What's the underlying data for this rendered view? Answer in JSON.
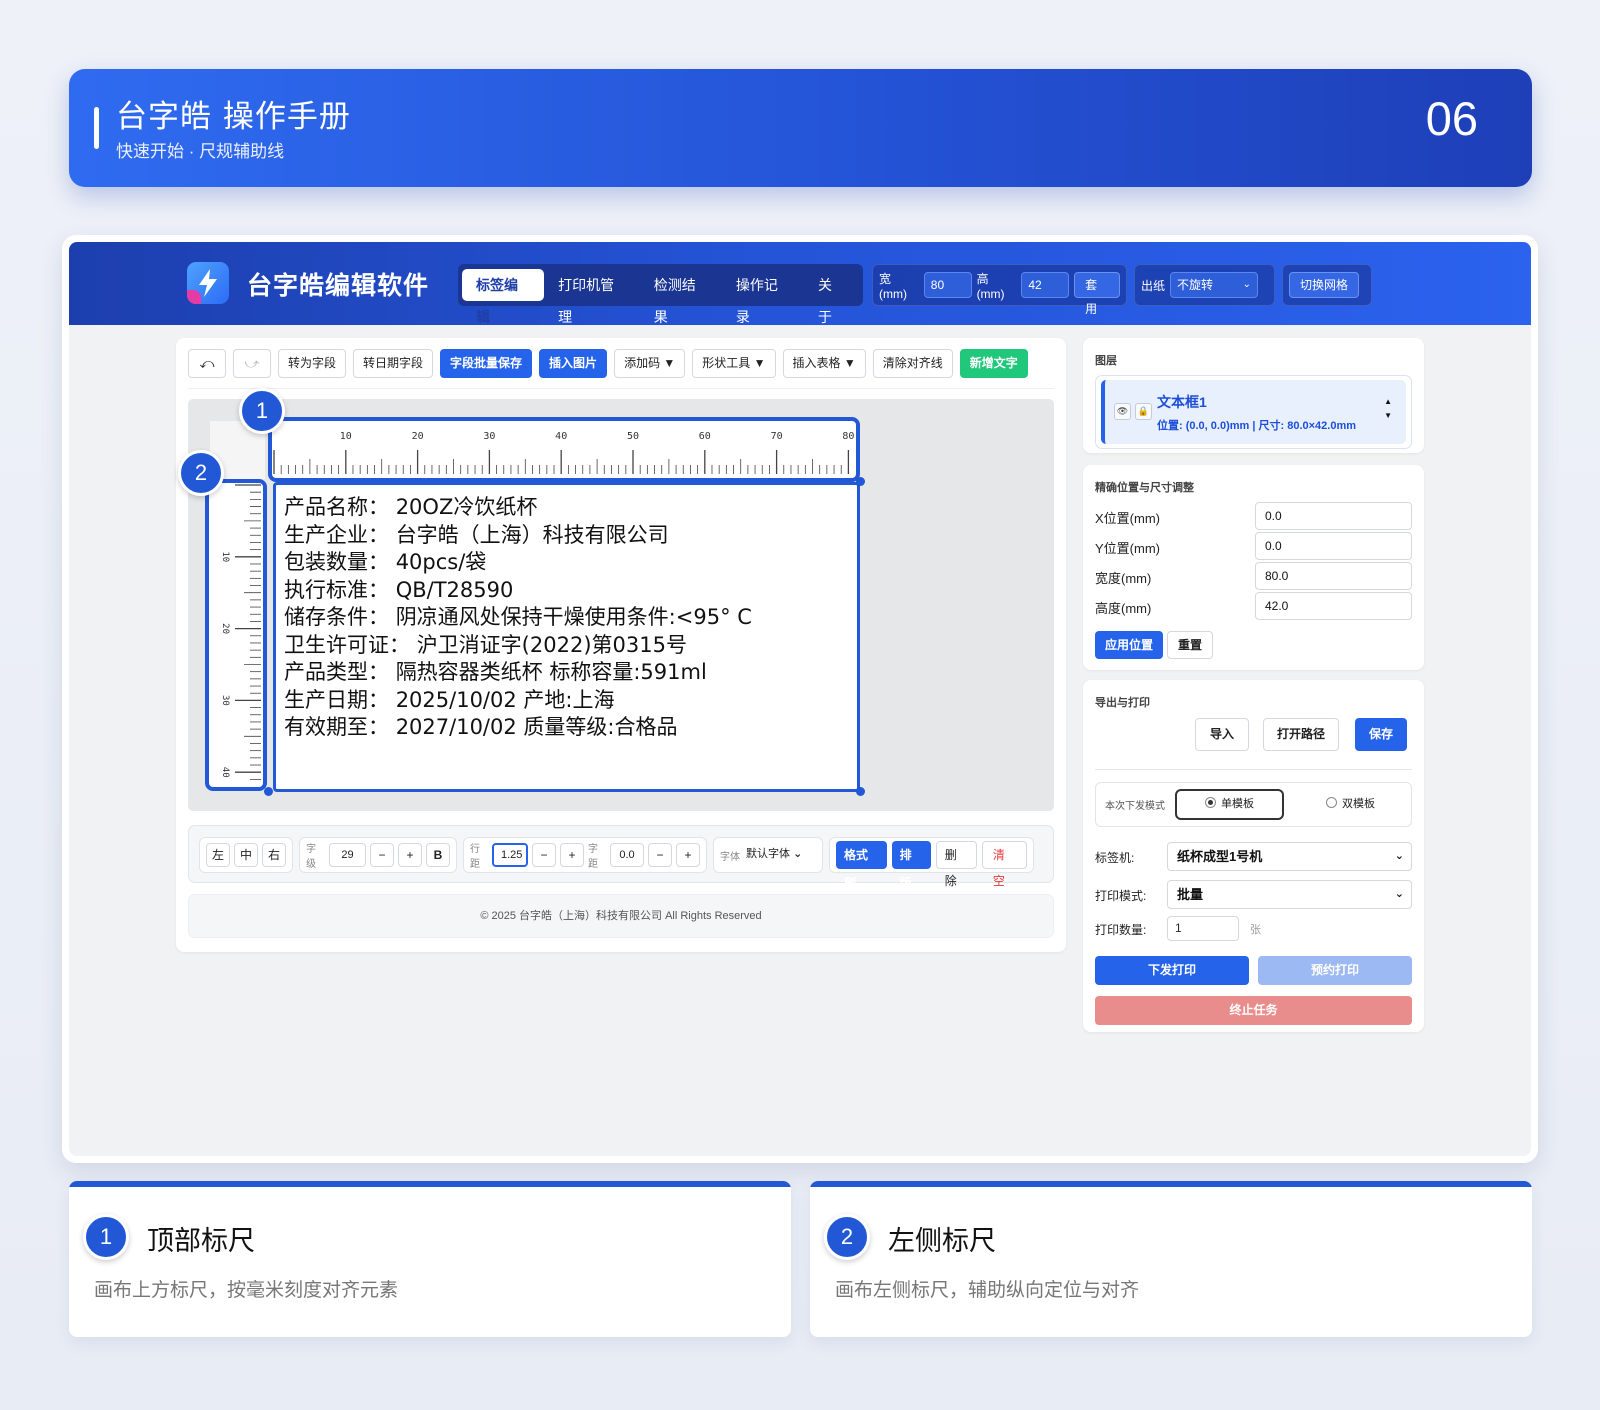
{
  "manual": {
    "title": "台字皓 操作手册",
    "subtitle": "快速开始 · 尺规辅助线",
    "page_number": "06"
  },
  "app": {
    "name": "台字皓编辑软件",
    "nav_tabs": [
      "标签编辑",
      "打印机管理",
      "检测结果",
      "操作记录",
      "关于"
    ],
    "active_tab": "标签编辑",
    "size_group": {
      "width_label": "宽(mm)",
      "width_value": "80",
      "height_label": "高(mm)",
      "height_value": "42",
      "apply_label": "套用"
    },
    "paper_group": {
      "label": "出纸",
      "value": "不旋转"
    },
    "grid_toggle_label": "切换网格"
  },
  "toolbar": {
    "undo_icon": "undo-icon",
    "redo_icon": "redo-icon",
    "buttons": [
      "转为字段",
      "转日期字段",
      "字段批量保存",
      "插入图片",
      "添加码 ▼",
      "形状工具 ▼",
      "插入表格 ▼",
      "清除对齐线",
      "新增文字"
    ]
  },
  "canvas": {
    "ruler_top_ticks": [
      "10",
      "20",
      "30",
      "40",
      "50",
      "60",
      "70",
      "80"
    ],
    "ruler_left_ticks": [
      "10",
      "20",
      "30",
      "40"
    ],
    "callouts": [
      "1",
      "2"
    ],
    "label_lines": [
      {
        "key": "产品名称：",
        "value": "20OZ冷饮纸杯"
      },
      {
        "key": "生产企业：",
        "value": "台字皓（上海）科技有限公司"
      },
      {
        "key": "包装数量：",
        "value": "40pcs/袋"
      },
      {
        "key": "执行标准：",
        "value": "QB/T28590"
      },
      {
        "key": "储存条件：",
        "value": "阴凉通风处保持干燥使用条件:<95° C"
      },
      {
        "key": "卫生许可证：",
        "value": "沪卫消证字(2022)第0315号"
      },
      {
        "key": "产品类型：",
        "value": "隔热容器类纸杯 标称容量:591ml"
      },
      {
        "key": "生产日期：",
        "value": "2025/10/02 产地:上海"
      },
      {
        "key": "有效期至：",
        "value": "2027/10/02 质量等级:合格品"
      }
    ]
  },
  "format_bar": {
    "align": [
      "左",
      "中",
      "右"
    ],
    "font_size_label": "字级",
    "font_size_value": "29",
    "minus": "−",
    "plus": "+",
    "bold": "B",
    "line_spacing_label": "行距",
    "line_spacing_value": "1.25",
    "char_spacing_label": "字距",
    "char_spacing_value": "0.0",
    "font_label": "字体",
    "font_value": "默认字体",
    "actions": [
      "格式刷",
      "排版",
      "删除",
      "清空"
    ]
  },
  "footer": {
    "copyright": "© 2025 台字皓（上海）科技有限公司 All Rights Reserved"
  },
  "layers": {
    "title": "图层",
    "item_name": "文本框1",
    "item_meta": "位置: (0.0, 0.0)mm | 尺寸: 80.0×42.0mm",
    "visible_icon": "eye-icon",
    "lock_icon": "lock-icon"
  },
  "position": {
    "title": "精确位置与尺寸调整",
    "fields": [
      {
        "label": "X位置(mm)",
        "value": "0.0"
      },
      {
        "label": "Y位置(mm)",
        "value": "0.0"
      },
      {
        "label": "宽度(mm)",
        "value": "80.0"
      },
      {
        "label": "高度(mm)",
        "value": "42.0"
      }
    ],
    "apply_label": "应用位置",
    "reset_label": "重置"
  },
  "export": {
    "title": "导出与打印",
    "import_label": "导入",
    "open_path_label": "打开路径",
    "save_label": "保存",
    "mode_label": "本次下发模式",
    "mode_single": "单模板",
    "mode_double": "双模板",
    "printer_label": "标签机:",
    "printer_value": "纸杯成型1号机",
    "print_mode_label": "打印模式:",
    "print_mode_value": "批量",
    "count_label": "打印数量:",
    "count_value": "1",
    "count_unit": "张",
    "send_print_label": "下发打印",
    "schedule_print_label": "预约打印",
    "stop_label": "终止任务"
  },
  "descriptions": [
    {
      "num": "1",
      "title": "顶部标尺",
      "text": "画布上方标尺，按毫米刻度对齐元素"
    },
    {
      "num": "2",
      "title": "左侧标尺",
      "text": "画布左侧标尺，辅助纵向定位与对齐"
    }
  ],
  "colors": {
    "brand_blue": "#2257d6",
    "primary": "#2563eb",
    "success": "#21c77a",
    "danger": "#e98c8c"
  }
}
